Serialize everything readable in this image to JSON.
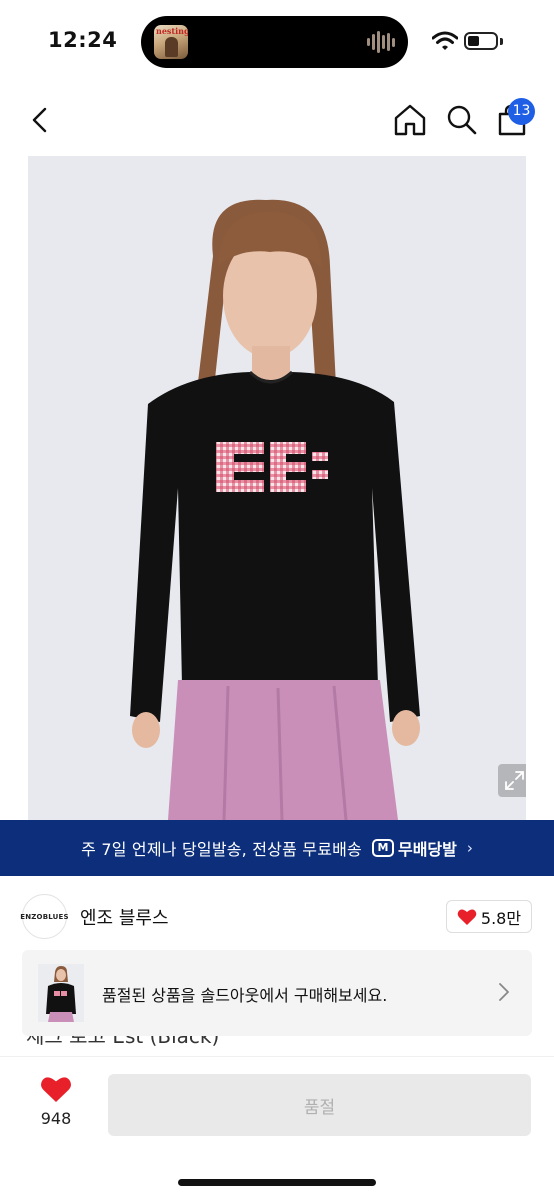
{
  "status_bar": {
    "time": "12:24",
    "now_playing_art_text": "nesting",
    "icons": [
      "wifi-icon",
      "battery-icon"
    ]
  },
  "nav": {
    "back_icon": "chevron-left-icon",
    "home_icon": "home-icon",
    "search_icon": "search-icon",
    "cart_icon": "shopping-bag-icon",
    "cart_count": "13",
    "accent_color": "#1f5fe6"
  },
  "product_image": {
    "graphic_letters": "EE",
    "expand_icon": "expand-icon"
  },
  "banner": {
    "text": "주 7일 언제나 당일발송, 전상품 무료배송",
    "logo_mark": "M",
    "logo_text": "무배당발",
    "chevron": "›",
    "background_color": "#0d2f7b"
  },
  "brand": {
    "logo_text": "ENZOBLUES",
    "name": "엔조 블루스",
    "likes": "5.8만",
    "heart_color": "#e8202a"
  },
  "product": {
    "title": "체크 로고 Est (Black)"
  },
  "soldout_suggestion": {
    "text": "품절된 상품을 솔드아웃에서 구매해보세요.",
    "thumb_letters": "EE"
  },
  "bottom_bar": {
    "like_count": "948",
    "buy_button_label": "품절"
  }
}
